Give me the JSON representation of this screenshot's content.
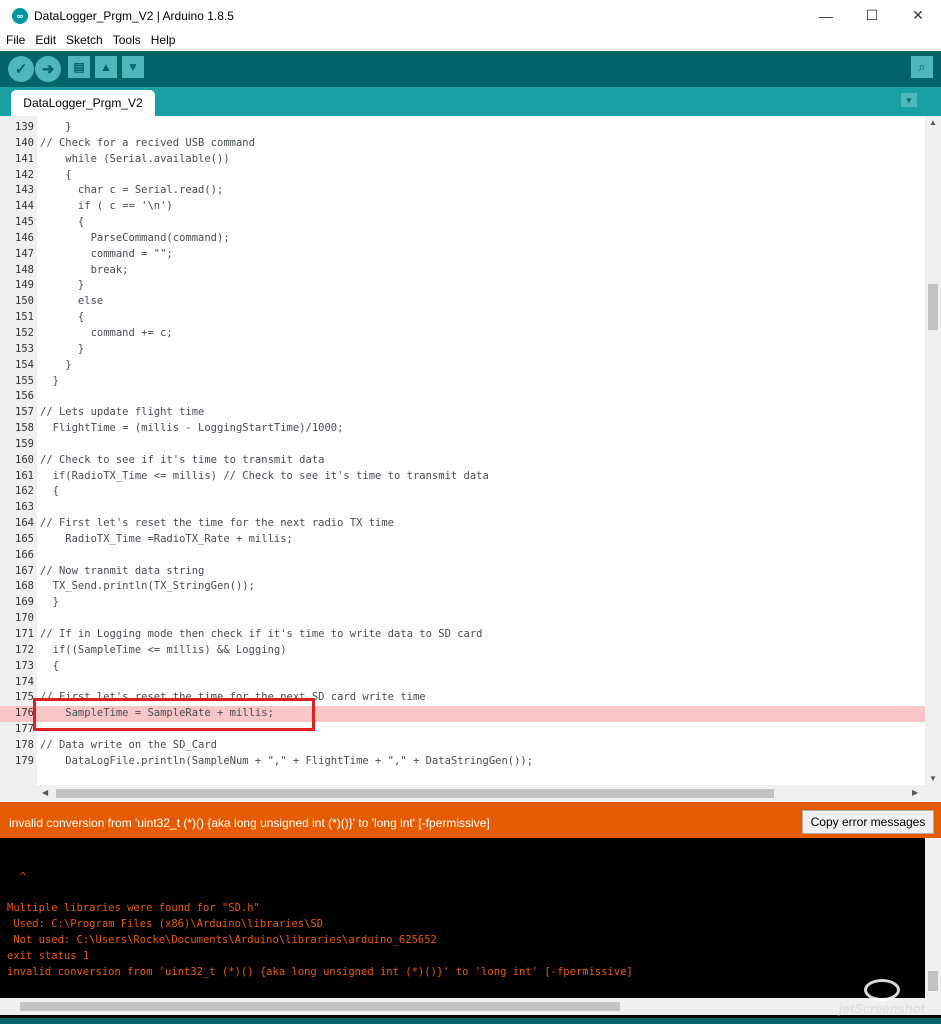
{
  "window": {
    "title": "DataLogger_Prgm_V2 | Arduino 1.8.5",
    "minimize": "—",
    "maximize": "☐",
    "close": "✕"
  },
  "menu": [
    "File",
    "Edit",
    "Sketch",
    "Tools",
    "Help"
  ],
  "toolbar": {
    "verify_icon": "check-icon",
    "upload_icon": "arrow-right-icon",
    "new_icon": "document-icon",
    "open_icon": "arrow-up-icon",
    "save_icon": "arrow-down-icon",
    "serial_monitor_icon": "magnifier-icon"
  },
  "tabs": [
    {
      "label": "DataLogger_Prgm_V2"
    }
  ],
  "editor": {
    "lines": [
      {
        "n": "139",
        "text": "    }"
      },
      {
        "n": "140",
        "text": "// Check for a recived USB command"
      },
      {
        "n": "141",
        "text": "    while (Serial.available())"
      },
      {
        "n": "142",
        "text": "    {"
      },
      {
        "n": "143",
        "text": "      char c = Serial.read();"
      },
      {
        "n": "144",
        "text": "      if ( c == '\\n')"
      },
      {
        "n": "145",
        "text": "      {"
      },
      {
        "n": "146",
        "text": "        ParseCommand(command);"
      },
      {
        "n": "147",
        "text": "        command = \"\";"
      },
      {
        "n": "148",
        "text": "        break;"
      },
      {
        "n": "149",
        "text": "      }"
      },
      {
        "n": "150",
        "text": "      else"
      },
      {
        "n": "151",
        "text": "      {"
      },
      {
        "n": "152",
        "text": "        command += c;"
      },
      {
        "n": "153",
        "text": "      }"
      },
      {
        "n": "154",
        "text": "    }"
      },
      {
        "n": "155",
        "text": "  }"
      },
      {
        "n": "156",
        "text": ""
      },
      {
        "n": "157",
        "text": "// Lets update flight time"
      },
      {
        "n": "158",
        "text": "  FlightTime = (millis - LoggingStartTime)/1000;"
      },
      {
        "n": "159",
        "text": ""
      },
      {
        "n": "160",
        "text": "// Check to see if it's time to transmit data"
      },
      {
        "n": "161",
        "text": "  if(RadioTX_Time <= millis) // Check to see it's time to transmit data"
      },
      {
        "n": "162",
        "text": "  {"
      },
      {
        "n": "163",
        "text": ""
      },
      {
        "n": "164",
        "text": "// First let's reset the time for the next radio TX time"
      },
      {
        "n": "165",
        "text": "    RadioTX_Time =RadioTX_Rate + millis;"
      },
      {
        "n": "166",
        "text": ""
      },
      {
        "n": "167",
        "text": "// Now tranmit data string"
      },
      {
        "n": "168",
        "text": "  TX_Send.println(TX_StringGen());"
      },
      {
        "n": "169",
        "text": "  }"
      },
      {
        "n": "170",
        "text": ""
      },
      {
        "n": "171",
        "text": "// If in Logging mode then check if it's time to write data to SD card"
      },
      {
        "n": "172",
        "text": "  if((SampleTime <= millis) && Logging)"
      },
      {
        "n": "173",
        "text": "  {"
      },
      {
        "n": "174",
        "text": ""
      },
      {
        "n": "175",
        "text": "// First let's reset the time for the next SD card write time"
      },
      {
        "n": "176",
        "text": "    SampleTime = SampleRate + millis;"
      },
      {
        "n": "177",
        "text": ""
      },
      {
        "n": "178",
        "text": "// Data write on the SD_Card"
      },
      {
        "n": "179",
        "text": "    DataLogFile.println(SampleNum + \",\" + FlightTime + \",\" + DataStringGen());"
      }
    ],
    "highlighted_line": "176"
  },
  "error_bar": {
    "message": "invalid conversion from 'uint32_t (*)() {aka long unsigned int (*)()}' to 'long int' [-fpermissive]",
    "copy_button": "Copy error messages"
  },
  "console": {
    "lines": [
      "",
      "",
      "  ^",
      "",
      "Multiple libraries were found for \"SD.h\"",
      " Used: C:\\Program Files (x86)\\Arduino\\libraries\\SD",
      " Not used: C:\\Users\\Rocke\\Documents\\Arduino\\libraries\\arduino_625652",
      "exit status 1",
      "invalid conversion from 'uint32_t (*)() {aka long unsigned int (*)()}' to 'long int' [-fpermissive]"
    ]
  },
  "watermark": "jetScreenshot",
  "colors": {
    "toolbar": "#006468",
    "tabbar": "#17a1a5",
    "error_orange": "#e55c00",
    "highlight": "#f8c6c6"
  }
}
